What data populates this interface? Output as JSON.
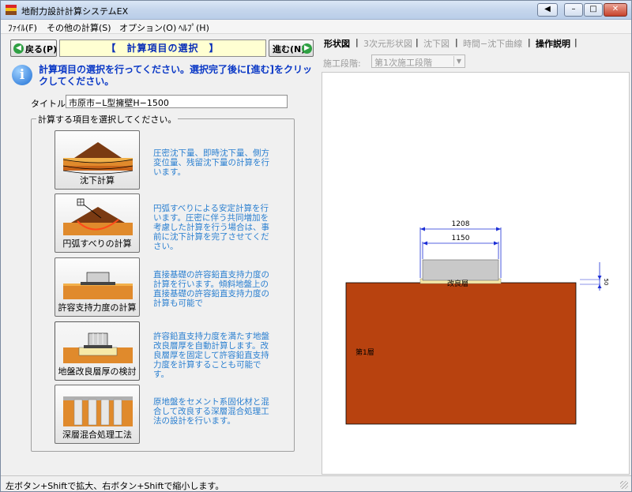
{
  "window": {
    "title": "地耐力設計計算システムEX",
    "controls": {
      "back": "◀",
      "minimize": "–",
      "maximize": "□",
      "close": "✕"
    }
  },
  "menu": [
    {
      "label": "ﾌｧｲﾙ(F)"
    },
    {
      "label": "その他の計算(S)"
    },
    {
      "label": "オプション(O)"
    },
    {
      "label": "ﾍﾙﾌﾟ(H)"
    }
  ],
  "nav": {
    "back_label": "戻る(P)",
    "step_title": "【　計算項目の選択　】",
    "next_label": "進む(N)"
  },
  "info": {
    "message": "計算項目の選択を行ってください。選択完了後に[進む]をクリックしてください。"
  },
  "title_field": {
    "label": "タイトル:",
    "value": "市原市−L型擁壁H−1500"
  },
  "group": {
    "legend": "計算する項目を選択してください。"
  },
  "calc_items": [
    {
      "label": "沈下計算",
      "desc": "圧密沈下量、即時沈下量、側方変位量、残留沈下量の計算を行います。"
    },
    {
      "label": "円弧すべりの計算",
      "desc": "円弧すべりによる安定計算を行います。圧密に伴う共同増加を考慮した計算を行う場合は、事前に沈下計算を完了させてください。"
    },
    {
      "label": "許容支持力度の計算",
      "desc": "直接基礎の許容鉛直支持力度の計算を行います。傾斜地盤上の直接基礎の許容鉛直支持力度の計算も可能で"
    },
    {
      "label": "地盤改良層厚の検討",
      "desc": "許容鉛直支持力度を満たす地盤改良層厚を自動計算します。改良層厚を固定して許容鉛直支持力度を計算することも可能です。"
    },
    {
      "label": "深層混合処理工法",
      "desc": "原地盤をセメント系固化材と混合して改良する深層混合処理工法の設計を行います。"
    }
  ],
  "tabs": [
    {
      "label": "形状図",
      "state": "active"
    },
    {
      "label": "3次元形状図",
      "state": "inactive"
    },
    {
      "label": "沈下図",
      "state": "inactive"
    },
    {
      "label": "時間−沈下曲線",
      "state": "inactive"
    },
    {
      "label": "操作説明",
      "state": "plain"
    }
  ],
  "stage": {
    "label": "施工段階:",
    "value": "第1次施工段階"
  },
  "diagram": {
    "dim_outer": "1208",
    "dim_inner": "1150",
    "improved_layer_label": "改良層",
    "layer1_label": "第1層",
    "right_dim": "50",
    "colors": {
      "ground": "#b8420f",
      "footing": "#c9c9c9",
      "improved": "#f6e9a8",
      "dimension": "#1d2fd6"
    }
  },
  "status": {
    "text": "左ボタン+Shiftで拡大、右ボタン+Shiftで縮小します。"
  }
}
